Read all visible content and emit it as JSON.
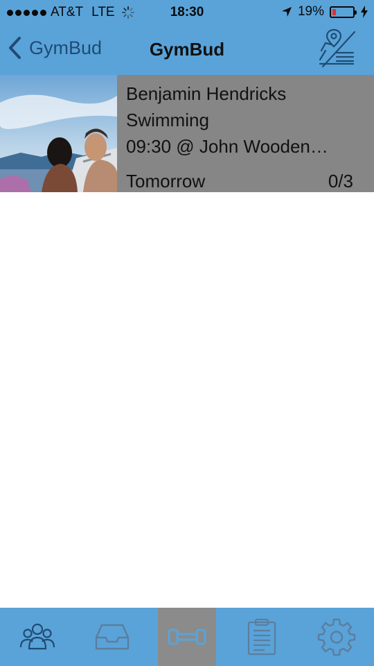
{
  "status_bar": {
    "carrier": "AT&T",
    "network": "LTE",
    "time": "18:30",
    "battery_text": "19%",
    "battery_level": 0.19
  },
  "nav": {
    "back_label": "GymBud",
    "title": "GymBud"
  },
  "workouts": [
    {
      "name": "Benjamin Hendricks",
      "activity": "Swimming",
      "time_location": "09:30 @  John Wooden…",
      "day": "Tomorrow",
      "count": "0/3"
    }
  ],
  "tabs": [
    {
      "icon": "people-icon",
      "active": false
    },
    {
      "icon": "inbox-icon",
      "active": false
    },
    {
      "icon": "dumbbell-icon",
      "active": true
    },
    {
      "icon": "clipboard-icon",
      "active": false
    },
    {
      "icon": "gear-icon",
      "active": false
    }
  ],
  "colors": {
    "bar_blue": "#5aa3d9",
    "row_gray": "#868686",
    "active_tab_gray": "#8b8b8b",
    "back_text": "#1f4b73"
  }
}
